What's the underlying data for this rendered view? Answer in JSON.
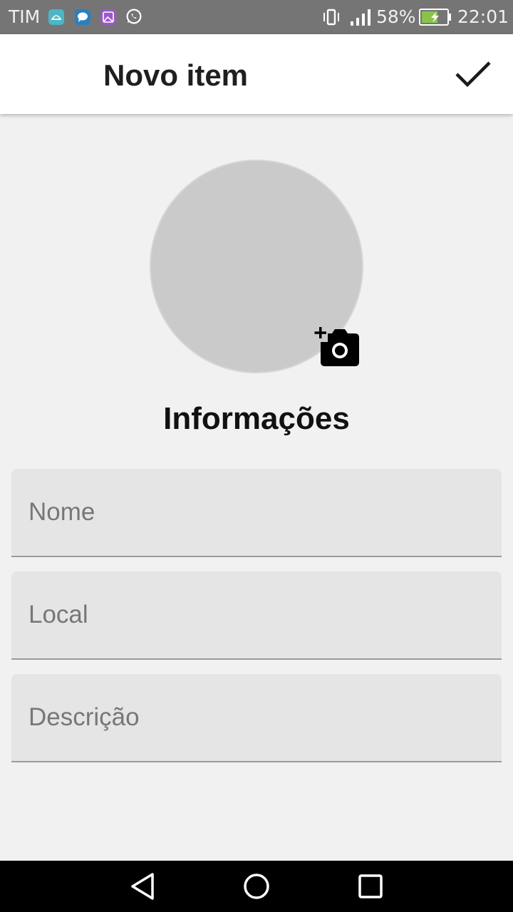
{
  "status_bar": {
    "carrier": "TIM",
    "battery_percent": "58%",
    "time": "22:01",
    "notification_icons": [
      "android-icon",
      "message-icon",
      "gallery-icon",
      "whatsapp-icon"
    ]
  },
  "app_bar": {
    "title": "Novo item",
    "confirm_icon": "check-icon"
  },
  "photo": {
    "add_photo_icon": "add-photo-camera-icon"
  },
  "section": {
    "title": "Informações"
  },
  "form": {
    "fields": [
      {
        "placeholder": "Nome",
        "value": ""
      },
      {
        "placeholder": "Local",
        "value": ""
      },
      {
        "placeholder": "Descrição",
        "value": ""
      }
    ]
  },
  "nav_bar": {
    "icons": [
      "back-icon",
      "home-icon",
      "recents-icon"
    ]
  },
  "colors": {
    "status_bar": "#757575",
    "app_bar": "#ffffff",
    "background": "#f1f1f1",
    "field_background": "#e5e5e5",
    "photo_placeholder": "#cacaca",
    "nav_bar": "#000000"
  }
}
